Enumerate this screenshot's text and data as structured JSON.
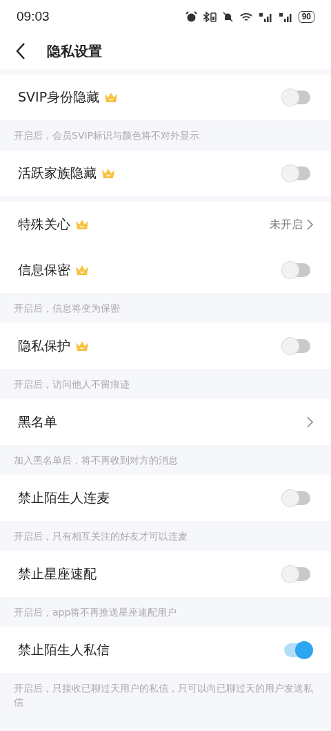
{
  "status_bar": {
    "time": "09:03",
    "battery": "90"
  },
  "header": {
    "title": "隐私设置"
  },
  "items": [
    {
      "kind": "gap"
    },
    {
      "kind": "toggle",
      "label": "SVIP身份隐藏",
      "crown": true,
      "on": false
    },
    {
      "kind": "note",
      "text": "开启后，会员SVIP标识与颜色将不对外显示"
    },
    {
      "kind": "toggle",
      "label": "活跃家族隐藏",
      "crown": true,
      "on": false
    },
    {
      "kind": "gap"
    },
    {
      "kind": "link",
      "label": "特殊关心",
      "crown": true,
      "value": "未开启"
    },
    {
      "kind": "toggle",
      "label": "信息保密",
      "crown": true,
      "on": false
    },
    {
      "kind": "note",
      "text": "开启后，信息将变为保密"
    },
    {
      "kind": "toggle",
      "label": "隐私保护",
      "crown": true,
      "on": false
    },
    {
      "kind": "note",
      "text": "开启后，访问他人不留痕迹"
    },
    {
      "kind": "link",
      "label": "黑名单",
      "crown": false
    },
    {
      "kind": "note",
      "text": "加入黑名单后，将不再收到对方的消息"
    },
    {
      "kind": "toggle",
      "label": "禁止陌生人连麦",
      "crown": false,
      "on": false
    },
    {
      "kind": "note",
      "text": "开启后，只有相互关注的好友才可以连麦"
    },
    {
      "kind": "toggle",
      "label": "禁止星座速配",
      "crown": false,
      "on": false
    },
    {
      "kind": "note",
      "text": "开启后，app将不再推送星座速配用户"
    },
    {
      "kind": "toggle",
      "label": "禁止陌生人私信",
      "crown": false,
      "on": true
    },
    {
      "kind": "note",
      "text": "开启后，只接收已聊过天用户的私信，只可以向已聊过天的用户发送私信"
    }
  ]
}
